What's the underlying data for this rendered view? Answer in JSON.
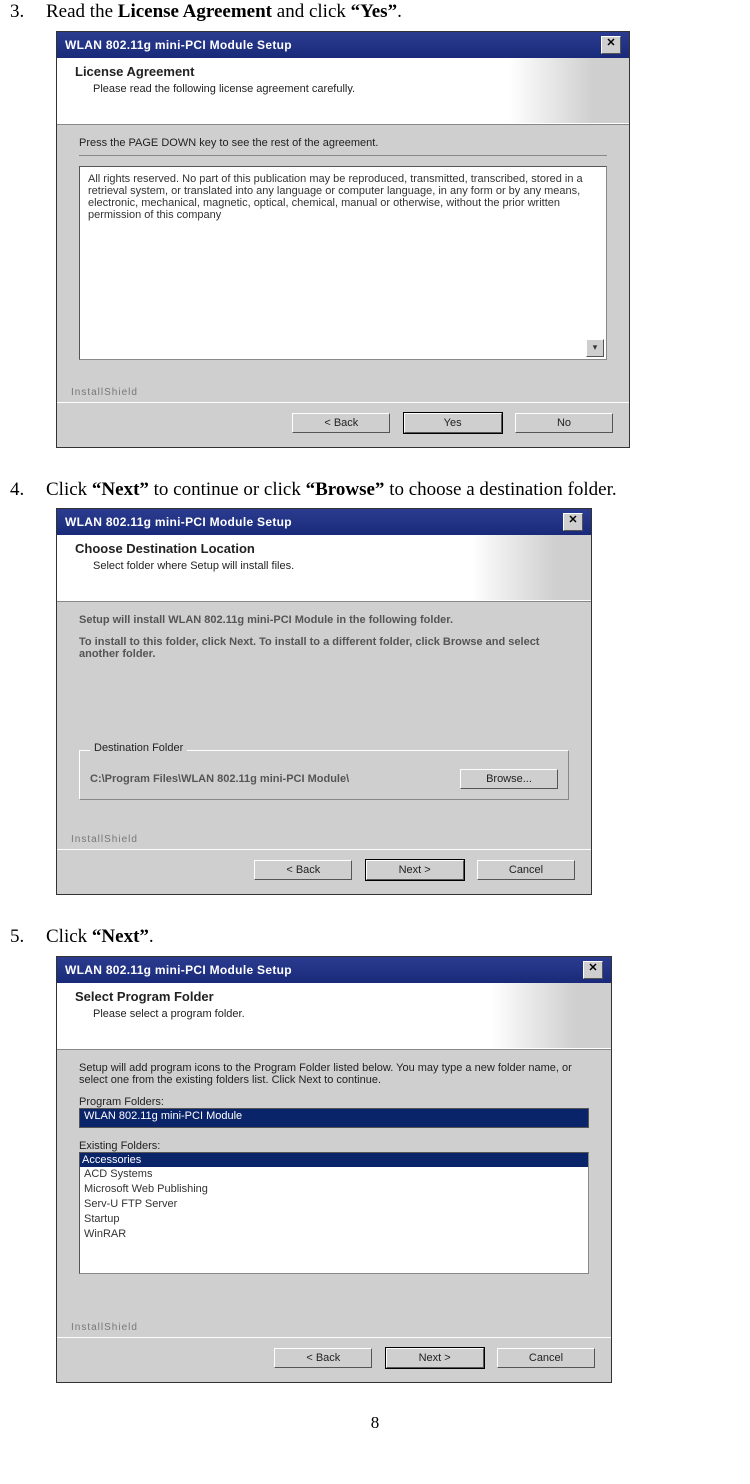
{
  "page_number": "8",
  "steps": {
    "s3": {
      "num": "3.",
      "pre": "Read the ",
      "bold1": "License Agreement",
      "mid": " and click ",
      "bold2": "“Yes”",
      "post": "."
    },
    "s4": {
      "num": "4.",
      "pre": "Click ",
      "bold1": "“Next”",
      "mid": " to continue or click ",
      "bold2": "“Browse”",
      "post": " to choose a destination folder."
    },
    "s5": {
      "num": "5.",
      "pre": "Click ",
      "bold1": "“Next”",
      "post": "."
    }
  },
  "dlg1": {
    "title": "WLAN 802.11g mini-PCI Module Setup",
    "hb_title": "License Agreement",
    "hb_sub": "Please read the following license agreement carefully.",
    "instruct": "Press the PAGE DOWN key to see the rest of the agreement.",
    "license_text": "All rights reserved. No part of this publication may be reproduced, transmitted, transcribed, stored in a retrieval system, or translated into any language or computer language, in any form or by any means, electronic, mechanical, magnetic, optical, chemical, manual or otherwise, without the prior written permission of this company",
    "installshield": "InstallShield",
    "btn_back": "< Back",
    "btn_yes": "Yes",
    "btn_no": "No"
  },
  "dlg2": {
    "title": "WLAN 802.11g mini-PCI Module Setup",
    "hb_title": "Choose Destination Location",
    "hb_sub": "Select folder where Setup will install files.",
    "body_l1": "Setup will install WLAN 802.11g mini-PCI Module in the following folder.",
    "body_l2": "To install to this folder, click Next. To install to a different folder, click Browse and select another folder.",
    "fieldset_legend": "Destination Folder",
    "path": "C:\\Program Files\\WLAN 802.11g mini-PCI Module\\",
    "btn_browse": "Browse...",
    "installshield": "InstallShield",
    "btn_back": "< Back",
    "btn_next": "Next >",
    "btn_cancel": "Cancel"
  },
  "dlg3": {
    "title": "WLAN 802.11g mini-PCI Module Setup",
    "hb_title": "Select Program Folder",
    "hb_sub": "Please select a program folder.",
    "body": "Setup will add program icons to the Program Folder listed below.  You may type a new folder name, or select one from the existing folders list.  Click Next to continue.",
    "label_program_folders": "Program Folders:",
    "program_folder_value": "WLAN 802.11g mini-PCI Module",
    "label_existing": "Existing Folders:",
    "existing": {
      "sel": "Accessories",
      "i1": "ACD Systems",
      "i2": "Microsoft Web Publishing",
      "i3": "Serv-U FTP Server",
      "i4": "Startup",
      "i5": "WinRAR"
    },
    "installshield": "InstallShield",
    "btn_back": "< Back",
    "btn_next": "Next >",
    "btn_cancel": "Cancel"
  }
}
